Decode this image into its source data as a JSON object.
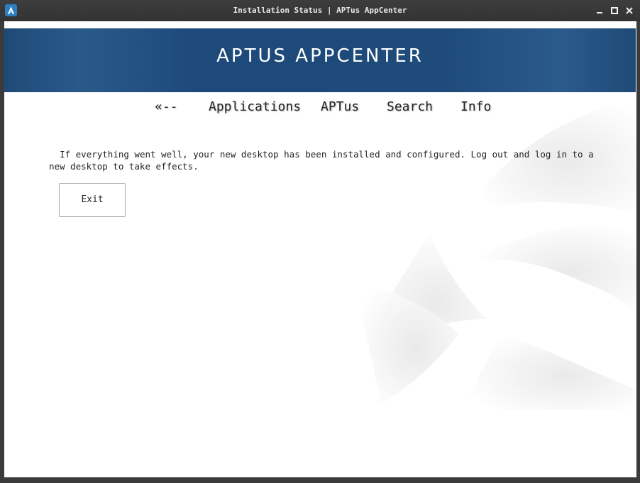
{
  "window": {
    "title": "Installation Status | APTus AppCenter",
    "controls": {
      "minimize": "–",
      "maximize": "◻",
      "close": "✕"
    },
    "icon": "aptus-logo-icon"
  },
  "banner": {
    "title": "APTUS APPCENTER",
    "color": "#1f4a78"
  },
  "nav": {
    "back": "«--",
    "applications": "Applications",
    "aptus": "APTus",
    "search": "Search",
    "info": "Info"
  },
  "content": {
    "message": "  If everything went well, your new desktop has been installed and configured. Log out and log in to a new desktop to take effects.",
    "exit_label": "Exit"
  }
}
